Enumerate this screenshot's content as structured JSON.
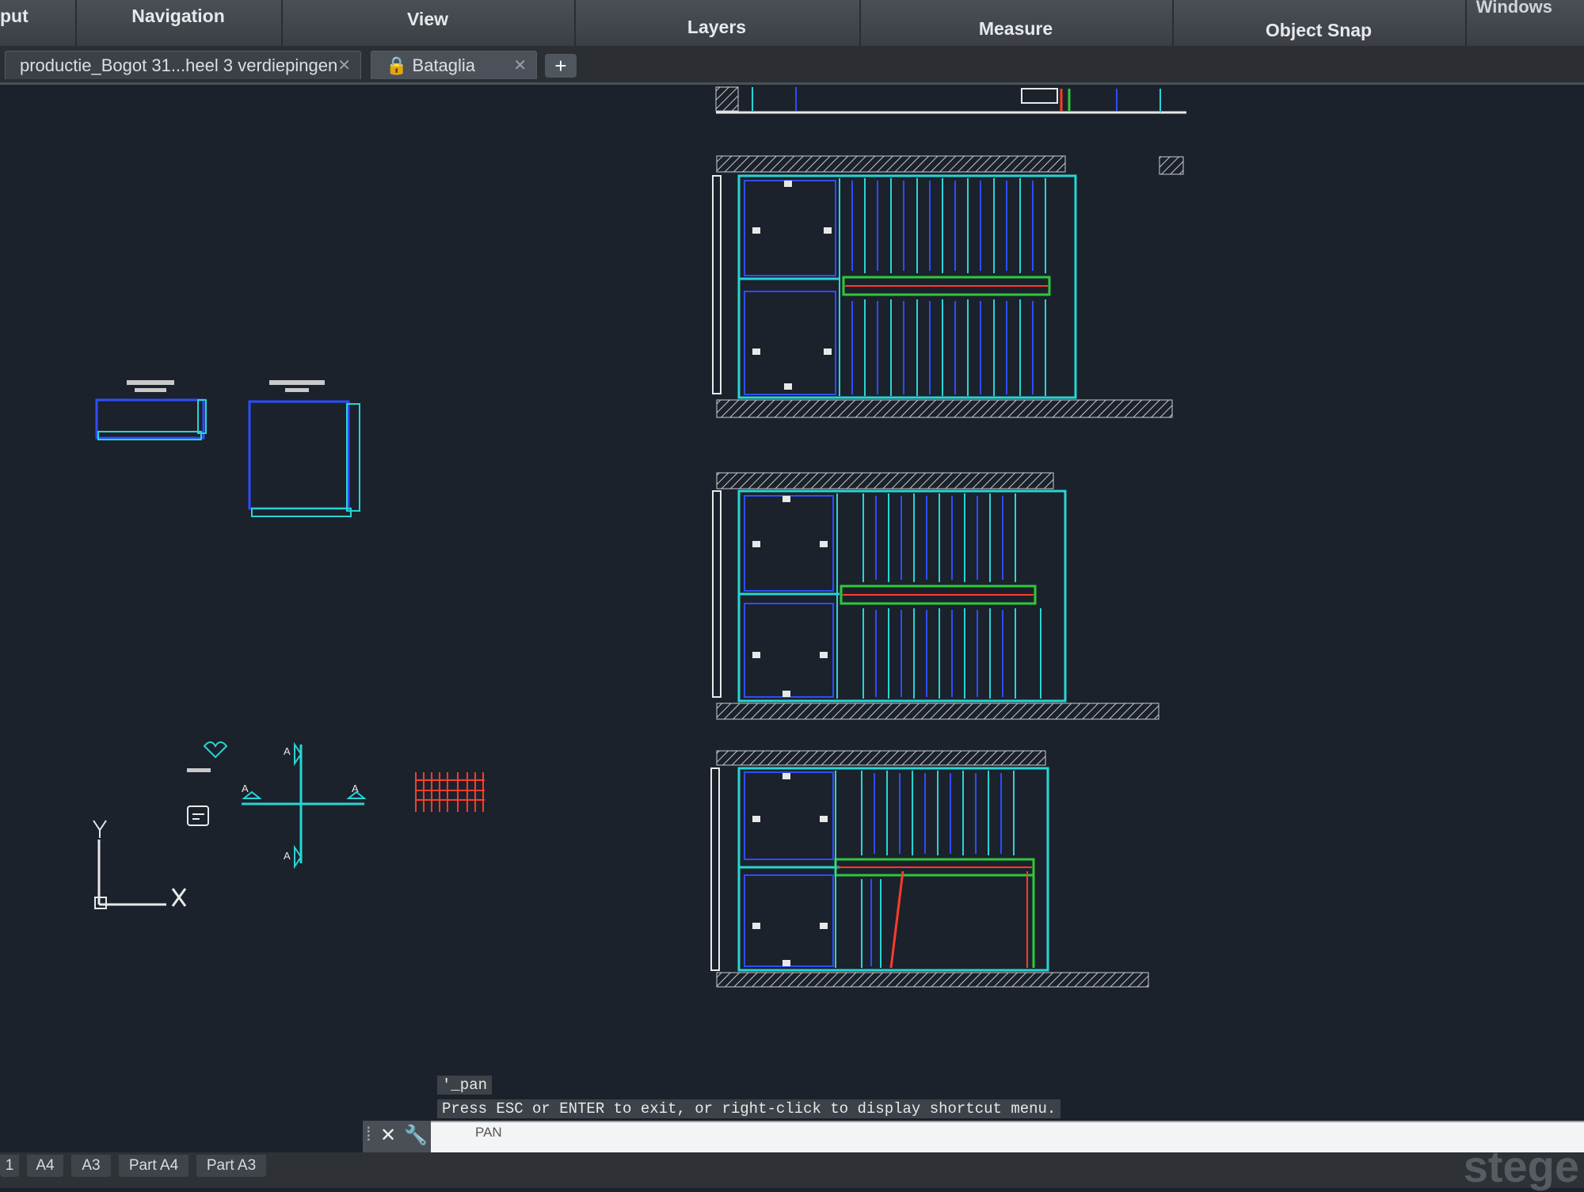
{
  "ribbon": {
    "panels": [
      "put",
      "Navigation",
      "View",
      "Layers",
      "Measure",
      "Object Snap"
    ],
    "windows_label": "Windows"
  },
  "tabs": {
    "file1": "productie_Bogot 31...heel 3 verdiepingen",
    "file2": "Bataglia",
    "new_tab": "+"
  },
  "drawing": {
    "section_label": "A",
    "colors": {
      "background": "#1b222c",
      "cyan": "#27d5d5",
      "blue": "#2d4dff",
      "green": "#2fc83a",
      "red": "#ff3b2b",
      "white": "#e8e8e8"
    }
  },
  "command": {
    "history": [
      "'_pan",
      "Press ESC or ENTER to exit, or right-click to display shortcut menu."
    ],
    "input": "PAN"
  },
  "layout_tabs": [
    "1",
    "A4",
    "A3",
    "Part A4",
    "Part A3"
  ],
  "watermark": "stege"
}
